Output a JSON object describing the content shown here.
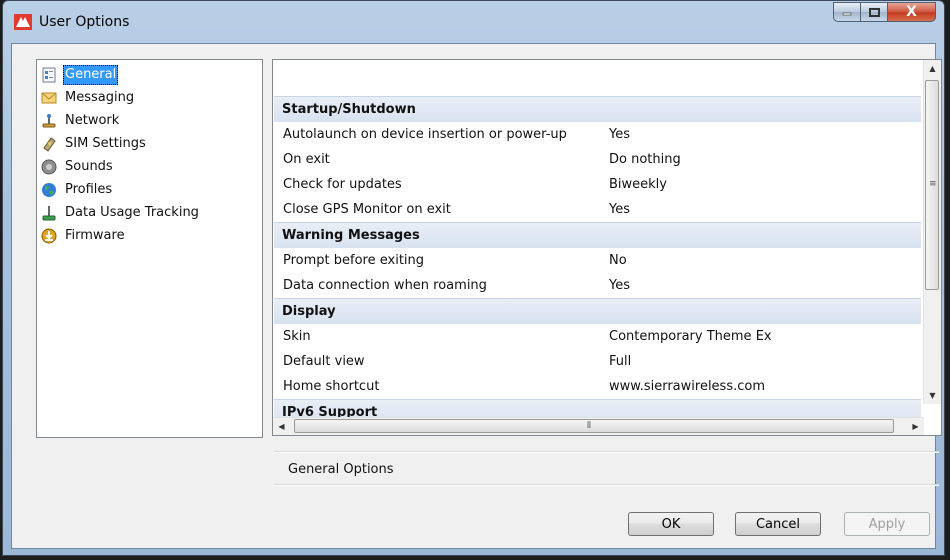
{
  "window": {
    "title": "User Options",
    "controls": {
      "minimize": "—",
      "maximize": "□",
      "close": "X"
    }
  },
  "nav": {
    "items": [
      {
        "label": "General",
        "icon": "general-icon",
        "selected": true
      },
      {
        "label": "Messaging",
        "icon": "envelope-icon"
      },
      {
        "label": "Network",
        "icon": "network-icon"
      },
      {
        "label": "SIM Settings",
        "icon": "sim-card-icon"
      },
      {
        "label": "Sounds",
        "icon": "speaker-icon"
      },
      {
        "label": "Profiles",
        "icon": "globe-icon"
      },
      {
        "label": "Data Usage Tracking",
        "icon": "data-usage-icon"
      },
      {
        "label": "Firmware",
        "icon": "download-icon"
      }
    ]
  },
  "properties": {
    "sections": [
      {
        "title": "Startup/Shutdown",
        "rows": [
          {
            "name": "Autolaunch on device insertion or power-up",
            "value": "Yes"
          },
          {
            "name": "On exit",
            "value": "Do nothing"
          },
          {
            "name": "Check for updates",
            "value": "Biweekly"
          },
          {
            "name": "Close GPS Monitor on exit",
            "value": "Yes"
          }
        ]
      },
      {
        "title": "Warning Messages",
        "rows": [
          {
            "name": "Prompt before exiting",
            "value": "No"
          },
          {
            "name": "Data connection when roaming",
            "value": "Yes"
          }
        ]
      },
      {
        "title": "Display",
        "rows": [
          {
            "name": "Skin",
            "value": "Contemporary Theme Ex"
          },
          {
            "name": "Default view",
            "value": "Full"
          },
          {
            "name": "Home shortcut",
            "value": "www.sierrawireless.com"
          }
        ]
      },
      {
        "title": "IPv6 Support",
        "rows": []
      }
    ]
  },
  "description": {
    "label": "General Options"
  },
  "buttons": {
    "ok": "OK",
    "cancel": "Cancel",
    "apply": "Apply"
  },
  "colors": {
    "selection": "#3399ff",
    "category_bg": "#dde5f1",
    "close_button": "#c43b22"
  }
}
